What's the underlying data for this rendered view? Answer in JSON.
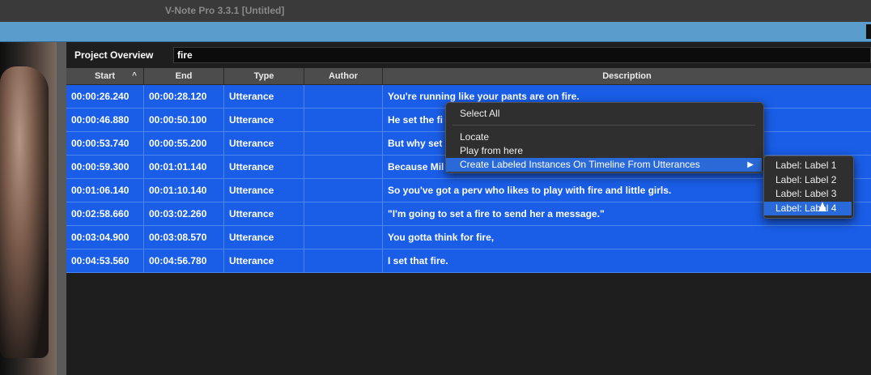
{
  "window": {
    "title": "V-Note Pro 3.3.1 [Untitled]"
  },
  "overview": {
    "label": "Project Overview",
    "search_value": "fire"
  },
  "columns": {
    "start": "Start",
    "sort_glyph": "^",
    "end": "End",
    "type": "Type",
    "author": "Author",
    "description": "Description"
  },
  "rows": [
    {
      "start": "00:00:26.240",
      "end": "00:00:28.120",
      "type": "Utterance",
      "author": "",
      "description": "You're running like your pants are on fire."
    },
    {
      "start": "00:00:46.880",
      "end": "00:00:50.100",
      "type": "Utterance",
      "author": "",
      "description": "He set the fi"
    },
    {
      "start": "00:00:53.740",
      "end": "00:00:55.200",
      "type": "Utterance",
      "author": "",
      "description": "But why set"
    },
    {
      "start": "00:00:59.300",
      "end": "00:01:01.140",
      "type": "Utterance",
      "author": "",
      "description": "Because Mil"
    },
    {
      "start": "00:01:06.140",
      "end": "00:01:10.140",
      "type": "Utterance",
      "author": "",
      "description": "So you've got a perv who likes to play with fire and little girls."
    },
    {
      "start": "00:02:58.660",
      "end": "00:03:02.260",
      "type": "Utterance",
      "author": "",
      "description": "\"I'm going to set a fire to send her a message.\""
    },
    {
      "start": "00:03:04.900",
      "end": "00:03:08.570",
      "type": "Utterance",
      "author": "",
      "description": "You gotta think for fire,"
    },
    {
      "start": "00:04:53.560",
      "end": "00:04:56.780",
      "type": "Utterance",
      "author": "",
      "description": "I set that fire."
    }
  ],
  "context_menu": {
    "select_all": "Select All",
    "locate": "Locate",
    "play_from_here": "Play from here",
    "create_labeled": "Create Labeled Instances On Timeline From Utterances",
    "submenu_arrow": "▶"
  },
  "submenu": {
    "items": [
      "Label: Label 1",
      "Label: Label 2",
      "Label: Label 3",
      "Label: Label 4"
    ],
    "highlighted": "Label: Label 4"
  },
  "colors": {
    "row_selected": "#1a5ee8",
    "menu_highlight": "#2a6ad8",
    "toolbar_blue": "#5a9ccc"
  }
}
